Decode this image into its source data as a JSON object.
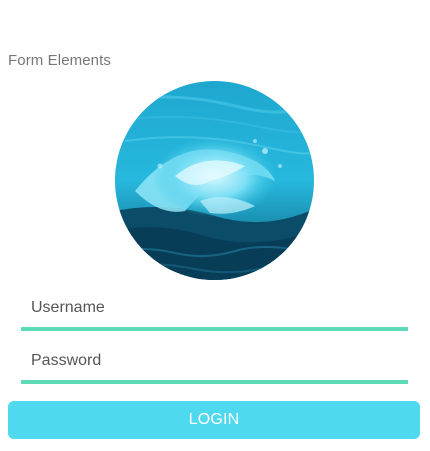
{
  "page": {
    "section_title": "Form Elements"
  },
  "avatar": {
    "image": "ocean-wave-photo"
  },
  "form": {
    "username_placeholder": "Username",
    "password_placeholder": "Password",
    "login_label": "LOGIN"
  },
  "colors": {
    "accent_line": "#5ddbb9",
    "button": "#4ed9f1",
    "wave_tint": "#2fc4e6"
  }
}
